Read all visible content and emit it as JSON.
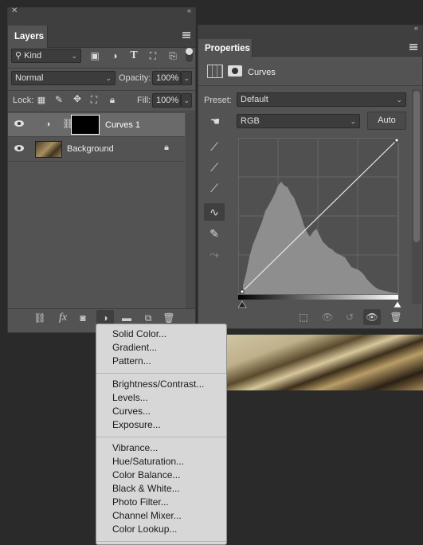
{
  "layers_panel": {
    "tab_label": "Layers",
    "filter_kind": "Kind",
    "blend_mode": "Normal",
    "opacity_label": "Opacity:",
    "opacity_value": "100%",
    "lock_label": "Lock:",
    "fill_label": "Fill:",
    "fill_value": "100%",
    "layers": [
      {
        "name": "Curves 1",
        "type": "adjustment",
        "selected": true
      },
      {
        "name": "Background",
        "type": "image",
        "locked": true
      }
    ]
  },
  "properties_panel": {
    "tab_label": "Properties",
    "adjustment_name": "Curves",
    "preset_label": "Preset:",
    "preset_value": "Default",
    "channel_value": "RGB",
    "auto_button": "Auto"
  },
  "context_menu": {
    "groups": [
      [
        "Solid Color...",
        "Gradient...",
        "Pattern..."
      ],
      [
        "Brightness/Contrast...",
        "Levels...",
        "Curves...",
        "Exposure..."
      ],
      [
        "Vibrance...",
        "Hue/Saturation...",
        "Color Balance...",
        "Black & White...",
        "Photo Filter...",
        "Channel Mixer...",
        "Color Lookup..."
      ]
    ]
  },
  "colors": {
    "panel_bg": "#535353",
    "menu_bg": "#d7d7d7",
    "histogram": "#8e8e8e"
  }
}
